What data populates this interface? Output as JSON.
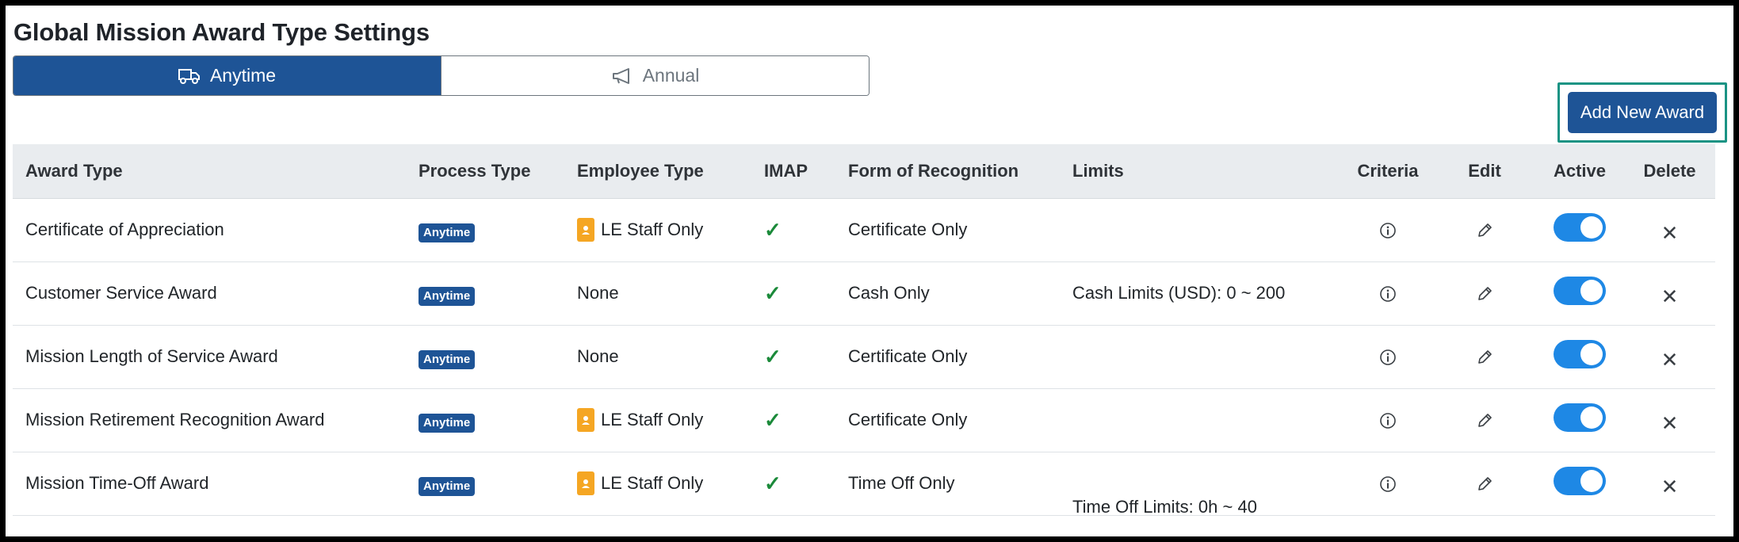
{
  "page": {
    "title": "Global Mission Award Type Settings"
  },
  "tabs": [
    {
      "label": "Anytime",
      "icon": "truck-icon",
      "active": true
    },
    {
      "label": "Annual",
      "icon": "megaphone-icon",
      "active": false
    }
  ],
  "add_button": {
    "label": "Add New Award"
  },
  "table": {
    "headers": {
      "award_type": "Award Type",
      "process_type": "Process Type",
      "employee_type": "Employee Type",
      "imap": "IMAP",
      "form": "Form of Recognition",
      "limits": "Limits",
      "criteria": "Criteria",
      "edit": "Edit",
      "active": "Active",
      "delete": "Delete"
    },
    "rows": [
      {
        "award_type": "Certificate of Appreciation",
        "process_type": "Anytime",
        "employee_type": "LE Staff Only",
        "imap": "✓",
        "form": "Certificate Only",
        "limits": "",
        "active": true
      },
      {
        "award_type": "Customer Service Award",
        "process_type": "Anytime",
        "employee_type": "None",
        "imap": "✓",
        "form": "Cash Only",
        "limits": "Cash Limits (USD): 0 ~ 200",
        "active": true
      },
      {
        "award_type": "Mission Length of Service Award",
        "process_type": "Anytime",
        "employee_type": "None",
        "imap": "✓",
        "form": "Certificate Only",
        "limits": "",
        "active": true
      },
      {
        "award_type": "Mission Retirement Recognition Award",
        "process_type": "Anytime",
        "employee_type": "LE Staff Only",
        "imap": "✓",
        "form": "Certificate Only",
        "limits": "",
        "active": true
      },
      {
        "award_type": "Mission Time-Off Award",
        "process_type": "Anytime",
        "employee_type": "LE Staff Only",
        "imap": "✓",
        "form": "Time Off Only",
        "limits": "Time Off Limits: 0h ~ 40",
        "active": true
      }
    ]
  },
  "colors": {
    "primary": "#1e5496",
    "toggle_on": "#1e88e5",
    "check": "#1b8a3a",
    "id_badge": "#f5a623",
    "highlight_border": "#1a9384"
  }
}
